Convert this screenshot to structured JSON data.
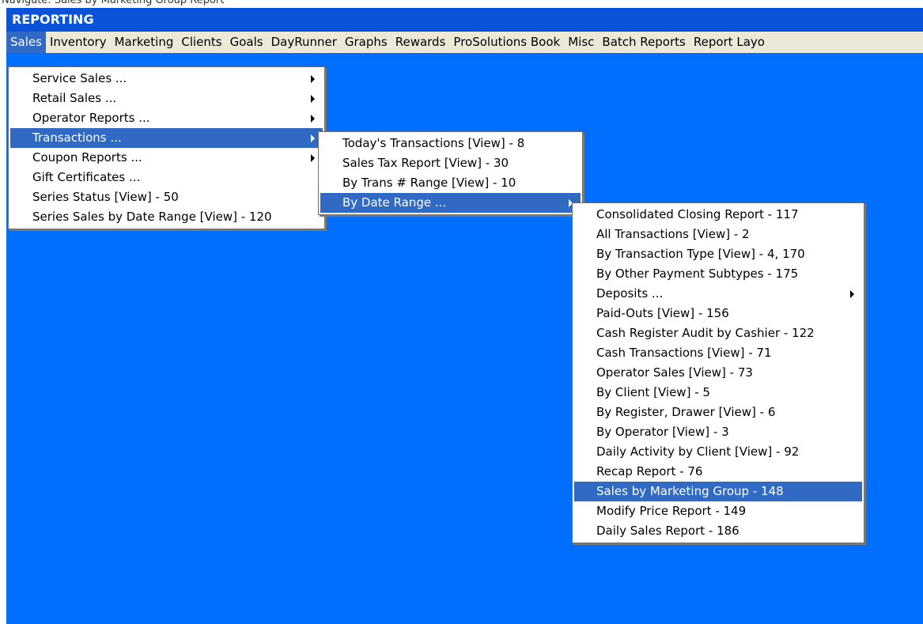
{
  "cutoff_caption": "Navigate: Sales by Marketing Group Report",
  "window": {
    "title": "REPORTING"
  },
  "menubar": {
    "items": [
      {
        "label": "Sales",
        "active": true
      },
      {
        "label": "Inventory"
      },
      {
        "label": "Marketing"
      },
      {
        "label": "Clients"
      },
      {
        "label": "Goals"
      },
      {
        "label": "DayRunner"
      },
      {
        "label": "Graphs"
      },
      {
        "label": "Rewards"
      },
      {
        "label": "ProSolutions Book"
      },
      {
        "label": "Misc"
      },
      {
        "label": "Batch Reports"
      },
      {
        "label": "Report Layo"
      }
    ]
  },
  "sales_menu": {
    "items": [
      {
        "label": "Service Sales ...",
        "submenu": true
      },
      {
        "label": "Retail Sales ...",
        "submenu": true
      },
      {
        "label": "Operator Reports ...",
        "submenu": true
      },
      {
        "label": "Transactions ...",
        "submenu": true,
        "highlighted": true
      },
      {
        "label": "Coupon Reports ...",
        "submenu": true
      },
      {
        "label": "Gift Certificates ..."
      },
      {
        "label": "Series Status [View] - 50"
      },
      {
        "label": "Series Sales by Date Range [View] - 120"
      }
    ]
  },
  "transactions_menu": {
    "items": [
      {
        "label": "Today's Transactions [View] - 8"
      },
      {
        "label": "Sales Tax Report [View] - 30"
      },
      {
        "label": "By Trans # Range [View] - 10"
      },
      {
        "label": "By Date Range ...",
        "submenu": true,
        "highlighted": true
      }
    ]
  },
  "date_range_menu": {
    "items": [
      {
        "label": "Consolidated Closing Report - 117"
      },
      {
        "label": "All Transactions [View] - 2"
      },
      {
        "label": "By Transaction Type [View] - 4, 170"
      },
      {
        "label": "By Other Payment Subtypes - 175"
      },
      {
        "label": "Deposits ...",
        "submenu": true
      },
      {
        "label": "Paid-Outs [View] - 156"
      },
      {
        "label": "Cash Register Audit by Cashier - 122"
      },
      {
        "label": "Cash Transactions [View] - 71"
      },
      {
        "label": "Operator Sales [View] - 73"
      },
      {
        "label": "By Client [View] - 5"
      },
      {
        "label": "By Register, Drawer [View] - 6"
      },
      {
        "label": "By Operator [View] - 3"
      },
      {
        "label": "Daily Activity by Client [View] - 92"
      },
      {
        "label": "Recap Report - 76"
      },
      {
        "label": "Sales by Marketing Group - 148",
        "highlighted": true
      },
      {
        "label": "Modify Price Report - 149"
      },
      {
        "label": "Daily Sales Report - 186"
      }
    ]
  },
  "colors": {
    "title_bar": "#0a52d8",
    "workspace": "#006eff",
    "menu_highlight": "#316ac5",
    "menubar": "#ece9d8"
  }
}
